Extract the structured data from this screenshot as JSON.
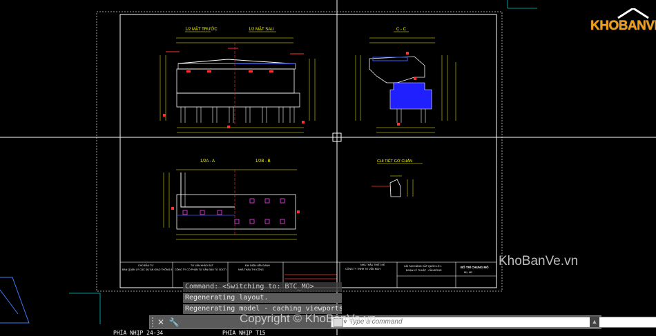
{
  "drawing": {
    "section_front": "1/2 MẶT TRƯỚC",
    "section_back": "1/2 MẶT SAU",
    "section_cc": "C - C",
    "section_aa": "1/2A - A",
    "section_bb": "1/2B - B",
    "section_detail": "CHI TIẾT GỜ CHẮN",
    "title_block": {
      "col1_line1": "CHỦ ĐẦU TƯ",
      "col1_line2": "BAN QUẢN LÝ CÁC DỰ ÁN GIAO THÔNG 8",
      "col2_line1": "TƯ VẤN KHẢO SÁT",
      "col2_line2": "CÔNG TY CỔ PHẦN TƯ VẤN ĐẦU TƯ XDCTI",
      "col3_line1": "ĐẠI DIỆN LIÊN DANH",
      "col3_line2": "NHÀ THẦU THI CÔNG",
      "col4_line1": "NHÀ THẦU THIẾT KẾ",
      "col4_line2": "CÔNG TY TNHH TƯ VẤN MCH",
      "col5_line1": "CẢI TẠO NÂNG CẤP QUỐC LỘ 1",
      "col5_line2": "ĐOẠN KÝ THUẬT - CẦN ĐỒNG",
      "col6_line1": "BỐ TRÍ CHUNG MỐ",
      "col6_line2": "M1, M2"
    }
  },
  "command": {
    "history": [
      "Command:  <Switching to: BTC_MO>",
      "Regenerating layout.",
      "Regenerating model - caching viewports."
    ],
    "placeholder": "Type a command",
    "close_icon": "close-icon",
    "settings_icon": "wrench-icon"
  },
  "layout_tabs": [
    "PHÍA NHỊP 24-34",
    "PHÍA NHỊP T15"
  ],
  "watermark": {
    "logo": "KHOBANVE",
    "right": "KhoBanVe.vn",
    "bottom": "Copyright © KhoBanVe.vn"
  },
  "colors": {
    "background": "#000000",
    "crosshair": "#ffffff",
    "sheet_border": "#ffffff",
    "dimension": "#ffff00",
    "accent_red": "#ff3030",
    "fill_blue": "#2020ff",
    "logo": "#f39c12"
  }
}
